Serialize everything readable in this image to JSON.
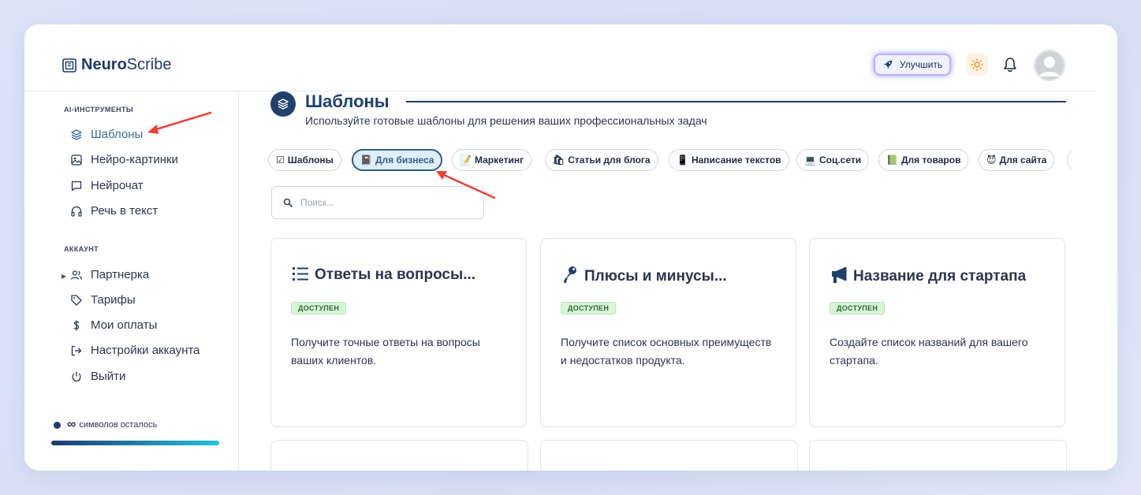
{
  "header": {
    "logo_bold": "Neuro",
    "logo_light": "Scribe",
    "upgrade_label": "Улучшить"
  },
  "sidebar": {
    "section_ai": "AI-ИНСТРУМЕНТЫ",
    "ai_items": [
      {
        "label": "Шаблоны",
        "icon": "layers-icon"
      },
      {
        "label": "Нейро-картинки",
        "icon": "image-icon"
      },
      {
        "label": "Нейрочат",
        "icon": "chat-icon"
      },
      {
        "label": "Речь в текст",
        "icon": "headphones-icon"
      }
    ],
    "section_account": "АККАУНТ",
    "account_items": [
      {
        "label": "Партнерка",
        "icon": "users-icon"
      },
      {
        "label": "Тарифы",
        "icon": "tag-icon"
      },
      {
        "label": "Мои оплаты",
        "icon": "dollar-icon"
      },
      {
        "label": "Настройки аккаунта",
        "icon": "exit-icon"
      },
      {
        "label": "Выйти",
        "icon": "power-icon"
      }
    ],
    "quota_symbol": "∞",
    "quota_text": "символов осталось"
  },
  "main": {
    "title": "Шаблоны",
    "subtitle": "Используйте готовые шаблоны для решения ваших профессиональных задач",
    "chips": [
      {
        "label": "Шаблоны",
        "emoji": "☑"
      },
      {
        "label": "Для бизнеса",
        "emoji": "📓"
      },
      {
        "label": "Маркетинг",
        "emoji": "📝"
      },
      {
        "label": "Статьи для блога",
        "emoji": "🛍"
      },
      {
        "label": "Написание текстов",
        "emoji": "📱"
      },
      {
        "label": "Соц.сети",
        "emoji": "💻"
      },
      {
        "label": "Для товаров",
        "emoji": "📗"
      },
      {
        "label": "Для сайта",
        "emoji": "😈"
      }
    ],
    "search_placeholder": "Поиск...",
    "cards": [
      {
        "title": "Ответы на вопросы...",
        "badge": "ДОСТУПЕН",
        "desc": "Получите точные ответы на вопросы ваших клиентов.",
        "icon": "list-icon"
      },
      {
        "title": "Плюсы и минусы...",
        "badge": "ДОСТУПЕН",
        "desc": "Получите список основных преимуществ и недостатков продукта.",
        "icon": "key-icon"
      },
      {
        "title": "Название для стартапа",
        "badge": "ДОСТУПЕН",
        "desc": "Создайте список названий для вашего стартапа.",
        "icon": "megaphone-icon"
      }
    ]
  },
  "colors": {
    "brand": "#1d3b6b",
    "active_chip_bg": "#e0eef8",
    "badge_bg": "#d8f5d8",
    "annotation_arrow": "#e8423a"
  }
}
